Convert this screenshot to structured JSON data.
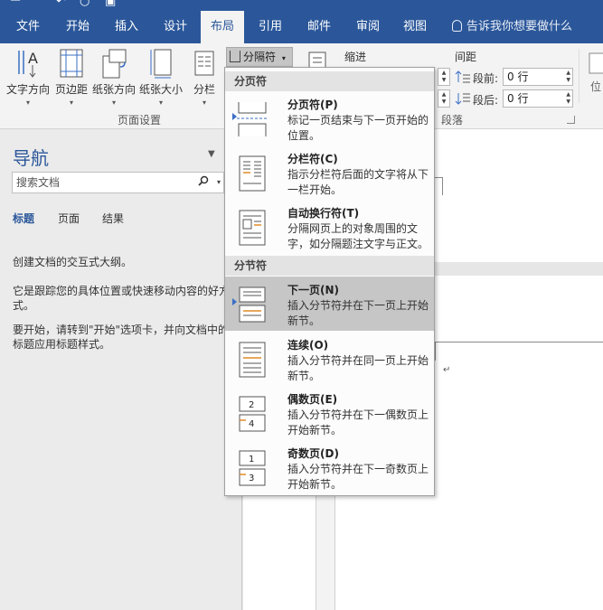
{
  "ribbon_tabs": [
    "文件",
    "开始",
    "插入",
    "设计",
    "布局",
    "引用",
    "邮件",
    "审阅",
    "视图"
  ],
  "active_tab": "布局",
  "tell_me": "告诉我你想要做什么",
  "ribbon": {
    "page_setup": {
      "buttons": [
        "文字方向",
        "页边距",
        "纸张方向",
        "纸张大小",
        "分栏"
      ],
      "group_label": "页面设置"
    },
    "breaks_button": "分隔符",
    "indent_label": "缩进",
    "spacing_label": "间距",
    "before_label": "段前:",
    "after_label": "段后:",
    "before_value": "0 行",
    "after_value": "0 行",
    "paragraph_group_label": "段落",
    "right_label": "位"
  },
  "nav_pane": {
    "title": "导航",
    "search_placeholder": "搜索文档",
    "tabs": [
      "标题",
      "页面",
      "结果"
    ],
    "active_tab": "标题",
    "text1": "创建文档的交互式大纲。",
    "text2a": "它是跟踪您的具体位置或快速移动内容的好方",
    "text2b": "式。",
    "text3a": "要开始，请转到\"开始\"选项卡，并向文档中的",
    "text3b": "标题应用标题样式。"
  },
  "breaks_menu": {
    "section1": "分页符",
    "section2": "分节符",
    "items": [
      {
        "title": "分页符(P)",
        "desc": "标记一页结束与下一页开始的位置。",
        "icon": "page-break-icon"
      },
      {
        "title": "分栏符(C)",
        "desc": "指示分栏符后面的文字将从下一栏开始。",
        "icon": "column-break-icon"
      },
      {
        "title": "自动换行符(T)",
        "desc": "分隔网页上的对象周围的文字，如分隔题注文字与正文。",
        "icon": "text-wrapping-icon"
      },
      {
        "title": "下一页(N)",
        "desc": "插入分节符并在下一页上开始新节。",
        "icon": "next-page-icon",
        "selected": true
      },
      {
        "title": "连续(O)",
        "desc": "插入分节符并在同一页上开始新节。",
        "icon": "continuous-icon"
      },
      {
        "title": "偶数页(E)",
        "desc": "插入分节符并在下一偶数页上开始新节。",
        "icon": "even-page-icon"
      },
      {
        "title": "奇数页(D)",
        "desc": "插入分节符并在下一奇数页上开始新节。",
        "icon": "odd-page-icon"
      }
    ]
  },
  "colors": {
    "brand": "#2b579a",
    "selected_item": "#c6c6c6"
  }
}
